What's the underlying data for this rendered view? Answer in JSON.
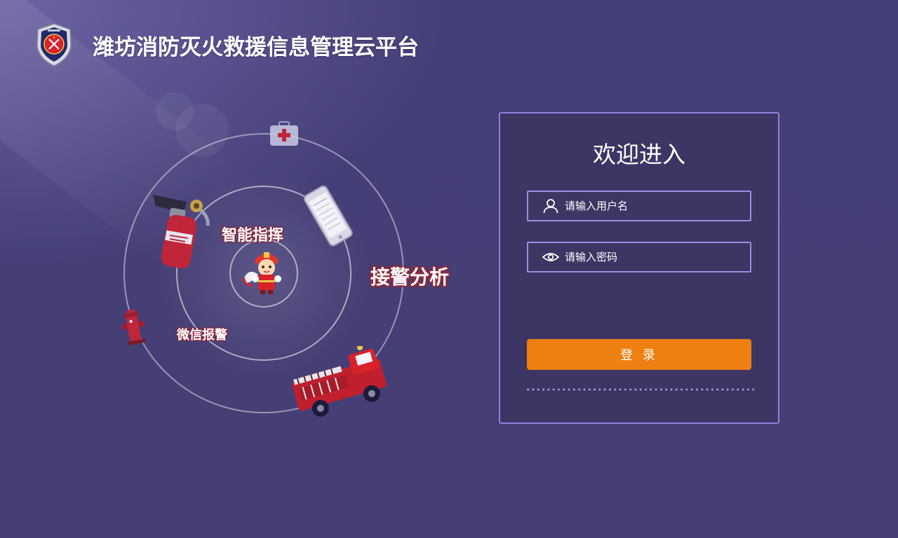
{
  "header": {
    "title": "潍坊消防灭火救援信息管理云平台",
    "logo_icon": "fire-rescue-emblem-icon"
  },
  "illustration": {
    "tag_command": "智能指挥",
    "tag_alarm_analysis": "接警分析",
    "tag_wechat_alarm": "微信报警",
    "icons": [
      "first-aid-kit-icon",
      "fire-extinguisher-icon",
      "mobile-phone-icon",
      "firefighter-mascot-icon",
      "fire-hydrant-icon",
      "fire-truck-icon"
    ]
  },
  "login": {
    "welcome": "欢迎进入",
    "username_placeholder": "请输入用户名",
    "password_placeholder": "请输入密码",
    "submit_label": "登 录",
    "user_icon": "user-icon",
    "eye_icon": "eye-icon"
  },
  "colors": {
    "background": "#463f77",
    "panel": "#3d3563",
    "panel_border": "#8f7fe0",
    "button": "#ee8012",
    "tag_outline": "#8d2a3a"
  }
}
